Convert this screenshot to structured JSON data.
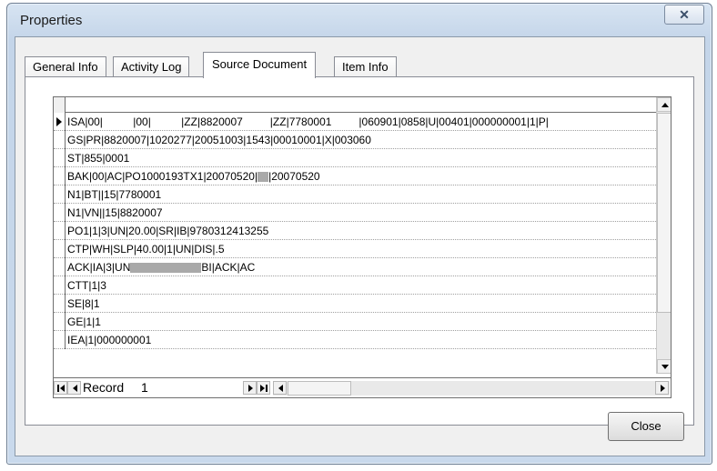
{
  "window": {
    "title": "Properties",
    "close_glyph": "✕"
  },
  "tabs": [
    {
      "label": "General Info",
      "active": false
    },
    {
      "label": "Activity Log",
      "active": false
    },
    {
      "label": "Source Document",
      "active": true
    },
    {
      "label": "Item Info",
      "active": false
    }
  ],
  "grid": {
    "rows": [
      {
        "text": "ISA|00|          |00|          |ZZ|8820007         |ZZ|7780001         |060901|0858|U|00401|000000001|1|P|",
        "selected": true
      },
      {
        "text": "GS|PR|8820007|1020277|20051003|1543|00010001|X|003060"
      },
      {
        "text": "ST|855|0001"
      },
      {
        "text_before": "BAK|00|AC|PO1000193TX1|20070520|",
        "redact_width": 12,
        "text_after": "|20070520"
      },
      {
        "text": "N1|BT||15|7780001"
      },
      {
        "text": "N1|VN||15|8820007"
      },
      {
        "text": "PO1|1|3|UN|20.00|SR|IB|9780312413255"
      },
      {
        "text": "CTP|WH|SLP|40.00|1|UN|DIS|.5"
      },
      {
        "text_before": "ACK|IA|3|UN",
        "redact_width": 78,
        "text_after": "BI|ACK|AC"
      },
      {
        "text": "CTT|1|3"
      },
      {
        "text": "SE|8|1"
      },
      {
        "text": "GE|1|1"
      },
      {
        "text": "IEA|1|000000001"
      }
    ]
  },
  "navigator": {
    "label": "Record",
    "value": "1"
  },
  "buttons": {
    "close": "Close"
  }
}
